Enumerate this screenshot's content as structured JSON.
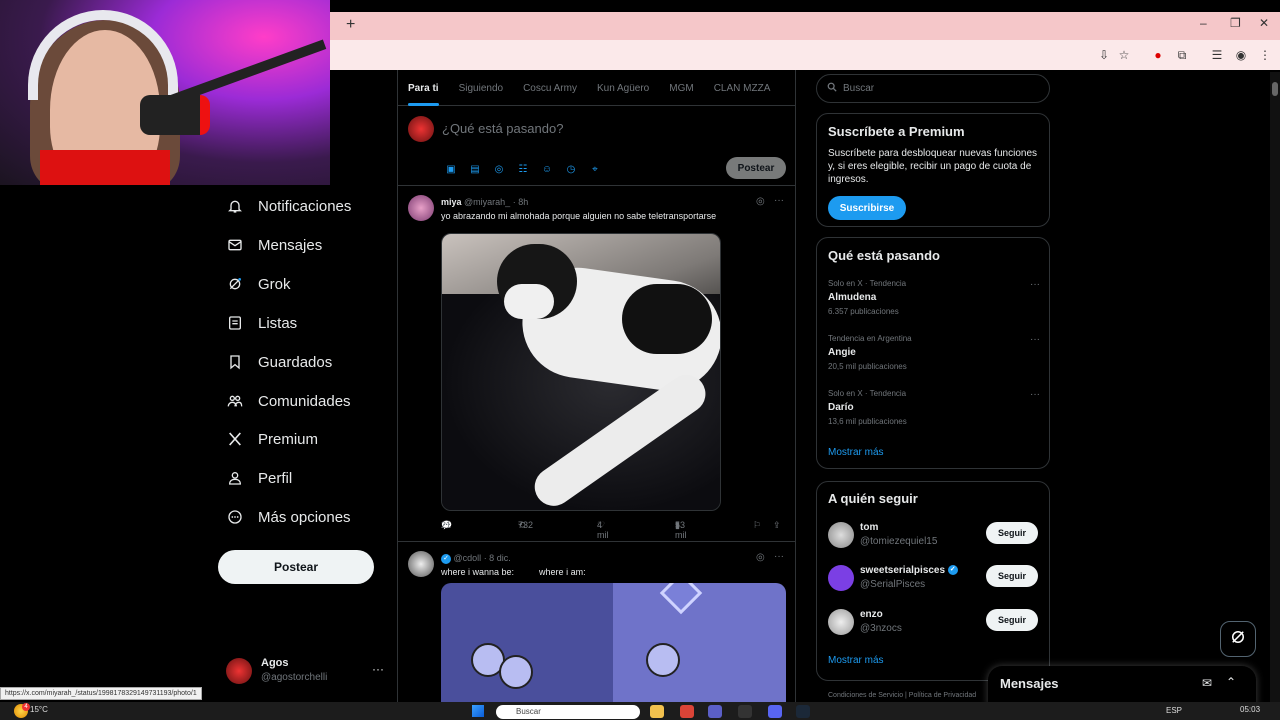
{
  "browser": {
    "new_tab": "+",
    "window_controls": [
      "–",
      "❐",
      "✕"
    ]
  },
  "nav": {
    "items": [
      {
        "label": "Notificaciones",
        "icon": "bell-icon"
      },
      {
        "label": "Mensajes",
        "icon": "envelope-icon"
      },
      {
        "label": "Grok",
        "icon": "grok-icon"
      },
      {
        "label": "Listas",
        "icon": "list-icon"
      },
      {
        "label": "Guardados",
        "icon": "bookmark-icon"
      },
      {
        "label": "Comunidades",
        "icon": "people-icon"
      },
      {
        "label": "Premium",
        "icon": "x-logo-icon"
      },
      {
        "label": "Perfil",
        "icon": "person-icon"
      },
      {
        "label": "Más opciones",
        "icon": "more-circle-icon"
      }
    ],
    "post_button": "Postear",
    "account": {
      "name": "Agos",
      "handle": "@agostorchelli",
      "more": "···"
    }
  },
  "timeline": {
    "tabs": [
      {
        "label": "Para ti",
        "active": true
      },
      {
        "label": "Siguiendo",
        "active": false
      },
      {
        "label": "Coscu Army",
        "active": false
      },
      {
        "label": "Kun Agüero",
        "active": false
      },
      {
        "label": "MGM",
        "active": false
      },
      {
        "label": "CLAN MZZA",
        "active": false
      }
    ],
    "compose": {
      "placeholder": "¿Qué está pasando?",
      "post_button": "Postear"
    },
    "tweets": [
      {
        "name": "miya",
        "handle": "@miyarah_",
        "time": "· 8h",
        "text": "yo abrazando mi almohada porque alguien no sabe teletransportarse",
        "replies": "21",
        "reposts": "732",
        "likes": "4 mil",
        "views": "53 mil"
      },
      {
        "name": "",
        "handle": "@cdoll",
        "time": "· 8 dic.",
        "text": "where i wanna be:          where i am:"
      }
    ]
  },
  "right": {
    "search_placeholder": "Buscar",
    "premium": {
      "title": "Suscríbete a Premium",
      "description": "Suscríbete para desbloquear nuevas funciones y, si eres elegible, recibir un pago de cuota de ingresos.",
      "button": "Suscribirse"
    },
    "trends": {
      "title": "Qué está pasando",
      "items": [
        {
          "context": "Solo en X · Tendencia",
          "name": "Almudena",
          "count": "6.357 publicaciones"
        },
        {
          "context": "Tendencia en Argentina",
          "name": "Angie",
          "count": "20,5 mil publicaciones"
        },
        {
          "context": "Solo en X · Tendencia",
          "name": "Darío",
          "count": "13,6 mil publicaciones"
        }
      ],
      "show_more": "Mostrar más"
    },
    "follow": {
      "title": "A quién seguir",
      "items": [
        {
          "name": "tom",
          "handle": "@tomiezequiel15",
          "verified": false,
          "button": "Seguir"
        },
        {
          "name": "sweetserialpisces",
          "handle": "@SerialPisces",
          "verified": true,
          "button": "Seguir"
        },
        {
          "name": "enzo",
          "handle": "@3nzocs",
          "verified": false,
          "button": "Seguir"
        }
      ],
      "show_more": "Mostrar más"
    },
    "footer": "Condiciones de Servicio  |  Política de Privacidad"
  },
  "messages_drawer": {
    "title": "Mensajes"
  },
  "status_url": "https://x.com/miyarah_/status/1998178329149731193/photo/1",
  "taskbar": {
    "weather": "15°C",
    "weather_badge": "4",
    "search": "Buscar",
    "lang": "ESP",
    "time": "05:03"
  }
}
